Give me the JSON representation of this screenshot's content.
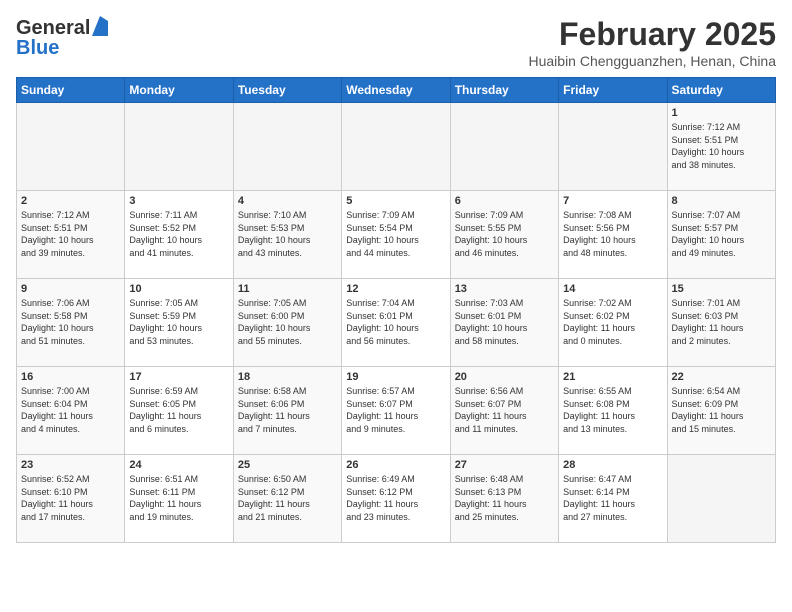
{
  "header": {
    "logo_line1": "General",
    "logo_line2": "Blue",
    "title": "February 2025",
    "subtitle": "Huaibin Chengguanzhen, Henan, China"
  },
  "weekdays": [
    "Sunday",
    "Monday",
    "Tuesday",
    "Wednesday",
    "Thursday",
    "Friday",
    "Saturday"
  ],
  "weeks": [
    [
      {
        "day": "",
        "info": ""
      },
      {
        "day": "",
        "info": ""
      },
      {
        "day": "",
        "info": ""
      },
      {
        "day": "",
        "info": ""
      },
      {
        "day": "",
        "info": ""
      },
      {
        "day": "",
        "info": ""
      },
      {
        "day": "1",
        "info": "Sunrise: 7:12 AM\nSunset: 5:51 PM\nDaylight: 10 hours\nand 38 minutes."
      }
    ],
    [
      {
        "day": "2",
        "info": "Sunrise: 7:12 AM\nSunset: 5:51 PM\nDaylight: 10 hours\nand 39 minutes."
      },
      {
        "day": "3",
        "info": "Sunrise: 7:11 AM\nSunset: 5:52 PM\nDaylight: 10 hours\nand 41 minutes."
      },
      {
        "day": "4",
        "info": "Sunrise: 7:10 AM\nSunset: 5:53 PM\nDaylight: 10 hours\nand 43 minutes."
      },
      {
        "day": "5",
        "info": "Sunrise: 7:09 AM\nSunset: 5:54 PM\nDaylight: 10 hours\nand 44 minutes."
      },
      {
        "day": "6",
        "info": "Sunrise: 7:09 AM\nSunset: 5:55 PM\nDaylight: 10 hours\nand 46 minutes."
      },
      {
        "day": "7",
        "info": "Sunrise: 7:08 AM\nSunset: 5:56 PM\nDaylight: 10 hours\nand 48 minutes."
      },
      {
        "day": "8",
        "info": "Sunrise: 7:07 AM\nSunset: 5:57 PM\nDaylight: 10 hours\nand 49 minutes."
      }
    ],
    [
      {
        "day": "9",
        "info": "Sunrise: 7:06 AM\nSunset: 5:58 PM\nDaylight: 10 hours\nand 51 minutes."
      },
      {
        "day": "10",
        "info": "Sunrise: 7:05 AM\nSunset: 5:59 PM\nDaylight: 10 hours\nand 53 minutes."
      },
      {
        "day": "11",
        "info": "Sunrise: 7:05 AM\nSunset: 6:00 PM\nDaylight: 10 hours\nand 55 minutes."
      },
      {
        "day": "12",
        "info": "Sunrise: 7:04 AM\nSunset: 6:01 PM\nDaylight: 10 hours\nand 56 minutes."
      },
      {
        "day": "13",
        "info": "Sunrise: 7:03 AM\nSunset: 6:01 PM\nDaylight: 10 hours\nand 58 minutes."
      },
      {
        "day": "14",
        "info": "Sunrise: 7:02 AM\nSunset: 6:02 PM\nDaylight: 11 hours\nand 0 minutes."
      },
      {
        "day": "15",
        "info": "Sunrise: 7:01 AM\nSunset: 6:03 PM\nDaylight: 11 hours\nand 2 minutes."
      }
    ],
    [
      {
        "day": "16",
        "info": "Sunrise: 7:00 AM\nSunset: 6:04 PM\nDaylight: 11 hours\nand 4 minutes."
      },
      {
        "day": "17",
        "info": "Sunrise: 6:59 AM\nSunset: 6:05 PM\nDaylight: 11 hours\nand 6 minutes."
      },
      {
        "day": "18",
        "info": "Sunrise: 6:58 AM\nSunset: 6:06 PM\nDaylight: 11 hours\nand 7 minutes."
      },
      {
        "day": "19",
        "info": "Sunrise: 6:57 AM\nSunset: 6:07 PM\nDaylight: 11 hours\nand 9 minutes."
      },
      {
        "day": "20",
        "info": "Sunrise: 6:56 AM\nSunset: 6:07 PM\nDaylight: 11 hours\nand 11 minutes."
      },
      {
        "day": "21",
        "info": "Sunrise: 6:55 AM\nSunset: 6:08 PM\nDaylight: 11 hours\nand 13 minutes."
      },
      {
        "day": "22",
        "info": "Sunrise: 6:54 AM\nSunset: 6:09 PM\nDaylight: 11 hours\nand 15 minutes."
      }
    ],
    [
      {
        "day": "23",
        "info": "Sunrise: 6:52 AM\nSunset: 6:10 PM\nDaylight: 11 hours\nand 17 minutes."
      },
      {
        "day": "24",
        "info": "Sunrise: 6:51 AM\nSunset: 6:11 PM\nDaylight: 11 hours\nand 19 minutes."
      },
      {
        "day": "25",
        "info": "Sunrise: 6:50 AM\nSunset: 6:12 PM\nDaylight: 11 hours\nand 21 minutes."
      },
      {
        "day": "26",
        "info": "Sunrise: 6:49 AM\nSunset: 6:12 PM\nDaylight: 11 hours\nand 23 minutes."
      },
      {
        "day": "27",
        "info": "Sunrise: 6:48 AM\nSunset: 6:13 PM\nDaylight: 11 hours\nand 25 minutes."
      },
      {
        "day": "28",
        "info": "Sunrise: 6:47 AM\nSunset: 6:14 PM\nDaylight: 11 hours\nand 27 minutes."
      },
      {
        "day": "",
        "info": ""
      }
    ]
  ]
}
